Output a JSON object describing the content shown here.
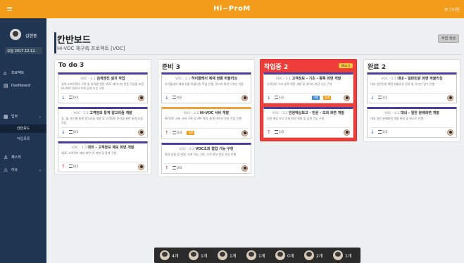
{
  "topbar": {
    "menu_glyph": "≡",
    "title": "Hi~ProM",
    "logout": "로그아웃"
  },
  "sidebar": {
    "user_name": "김현종",
    "date_label": "오늘 2017.12.12.",
    "items": [
      {
        "icon": "home-icon",
        "glyph": "⌂",
        "label": "프로젝트"
      },
      {
        "icon": "dashboard-icon",
        "glyph": "▤",
        "label": "Dashboard"
      },
      {
        "icon": "work-icon",
        "glyph": "▦",
        "label": "업무",
        "chevron": "⌄"
      },
      {
        "label": "칸반보드"
      },
      {
        "label": "작업목록"
      },
      {
        "icon": "thumb-icon",
        "glyph": "♙",
        "label": "제스처"
      },
      {
        "icon": "warning-icon",
        "glyph": "⚠",
        "label": "이슈",
        "chevron": "⌄"
      }
    ]
  },
  "page": {
    "title": "칸반보드",
    "subtitle": "Hi-VOC 재구축 프로젝트 [VOC]",
    "action_button": "작업 생성"
  },
  "columns": [
    {
      "title": "To do 3",
      "cards": [
        {
          "id": "VOC - 1.1",
          "title": "검색엔진 설치 작업",
          "desc": "검색 소프트웨어 구축 및 설치를 위한 VOC 데이터의 연동 작업을 포함 Hi-VOC 데이터 조회 검색 기능 구현",
          "count": "0/3",
          "priority": "down",
          "tags": []
        },
        {
          "id": "VOC - 1.2",
          "title": "고객정보 통계 알고리즘 개발",
          "desc": "일, 월, 분기별 통계 알고리즘 개발 및 고객정보 분석을 위한 통계 요청 작업",
          "count": "0/2",
          "priority": "down",
          "tags": []
        },
        {
          "id": "VOC - 1.3",
          "title": "대외 - 고객정보 제보 화면 개발",
          "desc": "VOC 고객정보 제보 화면 UI 개발 및 통계 구현",
          "count": "0/2",
          "priority": "up",
          "tags": []
        }
      ]
    },
    {
      "title": "준비 3",
      "cards": [
        {
          "id": "VOC - 2.1",
          "title": "하이플레이 제재 현황 퍼블리싱",
          "desc": "하이플레이 제재 현황 퍼블리싱 작업 진행, 관리자 화면 디자인 적용",
          "count": "0/2",
          "priority": "down",
          "tags": []
        },
        {
          "id": "VOC - 2.2",
          "title": "Hi-VOC 서비 개발",
          "desc": "Hi-VOC 서비 서버 구축 및 API 개발, 통계 데이터 전송 작업 진행",
          "count": "0/4",
          "priority": "up",
          "tags": [
            "개발"
          ]
        },
        {
          "id": "VOC - 2.3",
          "title": "VOC조회 협업 기능 구현",
          "desc": "협업 요청 및 VOC 조회 기능 구현, 고객 정보 연동 작업 진행",
          "count": "0/3",
          "priority": "up",
          "tags": []
        }
      ]
    },
    {
      "title": "작업중 2",
      "badge": "Max 3",
      "cards": [
        {
          "id": "VOC - 3.1",
          "title": "고객정보 - 기초 - 등록 화면 개발",
          "desc": "고객정보 기초 등록 화면 개발 및 데이터 저장 기능 구현",
          "count": "1/2",
          "priority": "down",
          "tags": [
            "개발",
            "설계"
          ]
        },
        {
          "id": "VOC - 3.2",
          "title": "민원예상보고 - 민원 - 조회 화면 개발",
          "desc": "민원 예상 보고 조회 화면 개발 및 검색 기능 구현",
          "count": "5/5",
          "priority": "up",
          "tags": []
        }
      ]
    },
    {
      "title": "완료 2",
      "cards": [
        {
          "id": "VOC - 4.1",
          "title": "대내 - 일반민원 화면 퍼블리싱",
          "desc": "대내 일반민원 화면 퍼블리싱 완료 및 디자인 검수 진행",
          "count": "2/2",
          "priority": "down",
          "tags": []
        },
        {
          "id": "VOC - 4.2",
          "title": "대내 - 일반 분배화면 개발",
          "desc": "대내 일반 분배화면 개발 완료 및 테스트 진행",
          "count": "2/2",
          "priority": "down",
          "tags": []
        }
      ]
    }
  ],
  "bottombar": [
    {
      "count": "4개"
    },
    {
      "count": "1개"
    },
    {
      "count": "1개"
    },
    {
      "count": "1개"
    },
    {
      "count": "0개"
    },
    {
      "count": "2개"
    },
    {
      "count": "1개"
    }
  ]
}
